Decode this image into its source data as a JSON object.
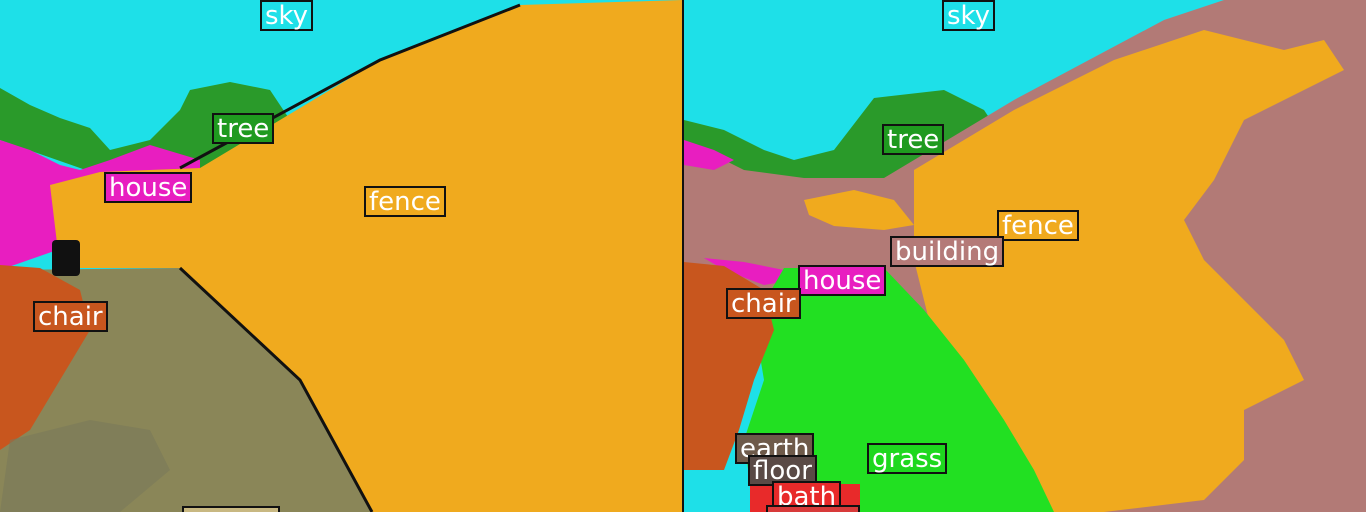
{
  "left_panel": {
    "labels": {
      "sky": {
        "text": "sky",
        "color": "#1ee0e8"
      },
      "tree": {
        "text": "tree",
        "color": "#1f9a1f"
      },
      "house": {
        "text": "house",
        "color": "#e81ec0"
      },
      "fence": {
        "text": "fence",
        "color": "#f0aa1e"
      },
      "chair": {
        "text": "chair",
        "color": "#c8561e"
      },
      "partial": {
        "text": "",
        "color": "#c8b882"
      }
    }
  },
  "right_panel": {
    "labels": {
      "sky": {
        "text": "sky",
        "color": "#1ee0e8"
      },
      "tree": {
        "text": "tree",
        "color": "#1f9a1f"
      },
      "fence": {
        "text": "fence",
        "color": "#f0aa1e"
      },
      "building": {
        "text": "building",
        "color": "#b47a78"
      },
      "house": {
        "text": "house",
        "color": "#e81ec0"
      },
      "chair": {
        "text": "chair",
        "color": "#c8561e"
      },
      "earth": {
        "text": "earth",
        "color": "#6e5a4a"
      },
      "floor": {
        "text": "floor",
        "color": "#5a4a46"
      },
      "grass": {
        "text": "grass",
        "color": "#1ed81e"
      },
      "bath": {
        "text": "bath",
        "color": "#e82a2a"
      },
      "table": {
        "text": "",
        "color": "#d83a3a"
      }
    }
  },
  "colors": {
    "sky": "#1ee0e8",
    "tree": "#2a9a2a",
    "fence": "#f0aa1e",
    "house": "#e81ec0",
    "building": "#b27a76",
    "chair": "#c8561e",
    "grass": "#22e022",
    "ground": "#8a8658"
  }
}
